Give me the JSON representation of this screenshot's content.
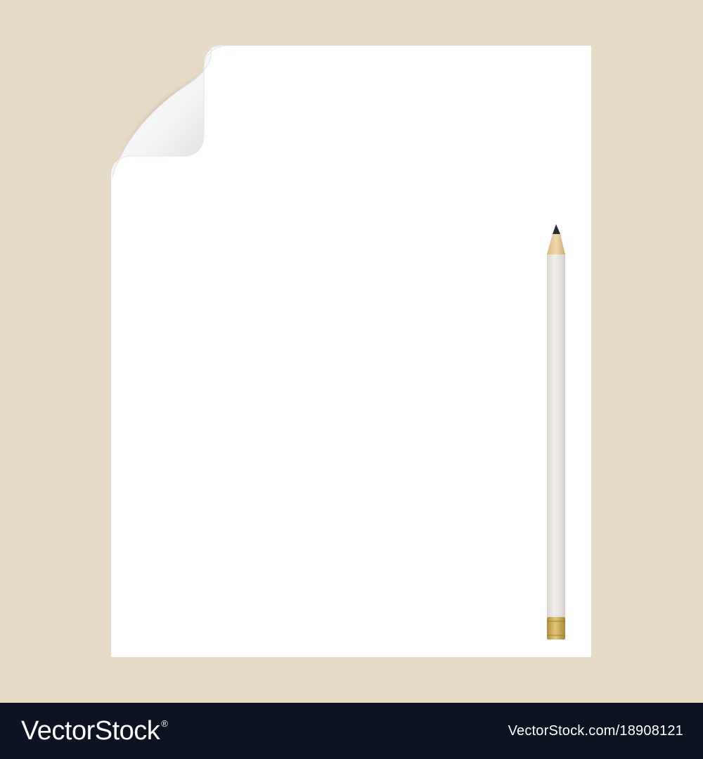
{
  "colors": {
    "background": "#e6dbc6",
    "paper": "#ffffff",
    "footer": "#0d1322",
    "footer_text": "#ffffff",
    "pencil_body": "#e9e5e1",
    "pencil_ferrule": "#c9a74f",
    "pencil_wood": "#e6c89a",
    "pencil_lead": "#2a2a30"
  },
  "icons": {
    "paper": "blank-sheet-icon",
    "curl": "page-curl-icon",
    "pencil": "pencil-icon"
  },
  "footer": {
    "brand": "VectorStock",
    "brand_mark": "®",
    "image_id": "VectorStock.com/18908121"
  }
}
